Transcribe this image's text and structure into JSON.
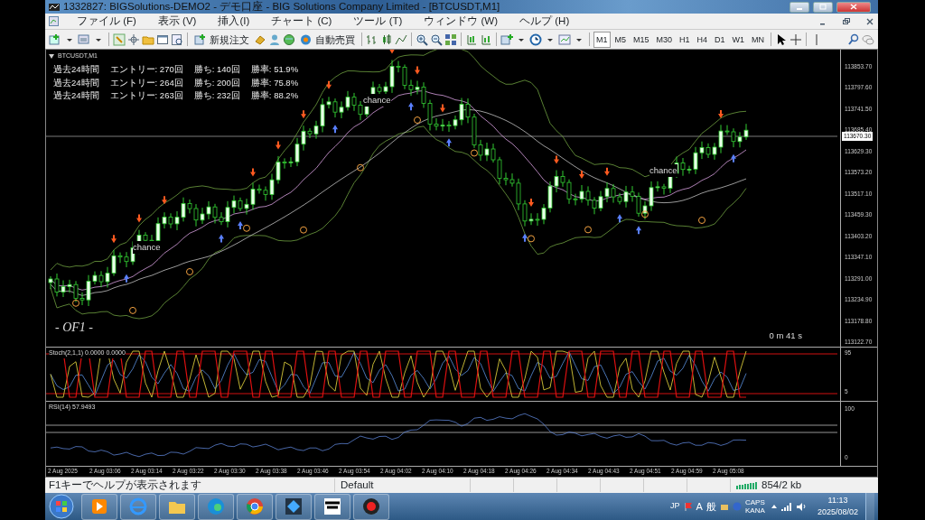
{
  "window": {
    "title": "1332827: BIGSolutions-DEMO2 - デモ口座 - BIG Solutions Company Limited - [BTCUSDT,M1]"
  },
  "menu": [
    "ファイル (F)",
    "表示 (V)",
    "挿入(I)",
    "チャート (C)",
    "ツール (T)",
    "ウィンドウ (W)",
    "ヘルプ (H)"
  ],
  "toolbar": {
    "new_order": "新規注文",
    "auto_trading": "自動売買",
    "timeframes": [
      {
        "label": "M1",
        "selected": true
      },
      {
        "label": "M5",
        "selected": false
      },
      {
        "label": "M15",
        "selected": false
      },
      {
        "label": "M30",
        "selected": false
      },
      {
        "label": "H1",
        "selected": false
      },
      {
        "label": "H4",
        "selected": false
      },
      {
        "label": "D1",
        "selected": false
      },
      {
        "label": "W1",
        "selected": false
      },
      {
        "label": "MN",
        "selected": false
      }
    ]
  },
  "chart": {
    "symbol": "BTCUSDT,M1",
    "stats": [
      {
        "period": "過去24時間",
        "entries": "エントリー: 270回",
        "wins": "勝ち: 140回",
        "rate": "勝率: 51.9%"
      },
      {
        "period": "過去24時間",
        "entries": "エントリー: 264回",
        "wins": "勝ち: 200回",
        "rate": "勝率: 75.8%"
      },
      {
        "period": "過去24時間",
        "entries": "エントリー: 263回",
        "wins": "勝ち: 232回",
        "rate": "勝率: 88.2%"
      }
    ],
    "signals": [
      "chance",
      "chance",
      "chance"
    ],
    "overlay_text": "- OF1 -",
    "countdown": "0 m 41 s",
    "price_ticks": [
      "113853.70",
      "113797.60",
      "113741.50",
      "113685.40",
      "113629.30",
      "113573.20",
      "113517.10",
      "113459.30",
      "113403.20",
      "113347.10",
      "113291.00",
      "113234.90",
      "113178.80",
      "113122.70"
    ],
    "current_price": "113670.30"
  },
  "stochastic": {
    "label": "Stoch(2,1,1) 0.0000 0.0000",
    "ticks": [
      "95",
      "5"
    ]
  },
  "rsi": {
    "label": "RSI(14) 57.9493",
    "ticks": [
      "100",
      "0"
    ]
  },
  "time_axis": [
    "2 Aug 2025",
    "2 Aug 03:06",
    "2 Aug 03:14",
    "2 Aug 03:22",
    "2 Aug 03:30",
    "2 Aug 03:38",
    "2 Aug 03:46",
    "2 Aug 03:54",
    "2 Aug 04:02",
    "2 Aug 04:10",
    "2 Aug 04:18",
    "2 Aug 04:26",
    "2 Aug 04:34",
    "2 Aug 04:43",
    "2 Aug 04:51",
    "2 Aug 04:59",
    "2 Aug 05:08"
  ],
  "status_bar": {
    "help": "F1キーでヘルプが表示されます",
    "profile": "Default",
    "traffic": "854/2 kb"
  },
  "taskbar": {
    "ime": "JP",
    "input_mode": "A",
    "dictionary": "般",
    "keys": "CAPS KANA",
    "time": "11:13",
    "date": "2025/08/02"
  }
}
